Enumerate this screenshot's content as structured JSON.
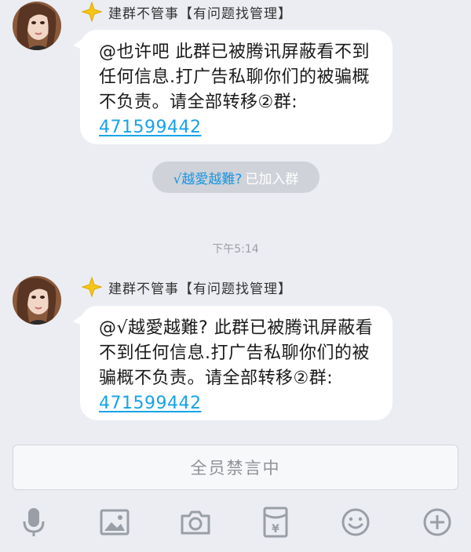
{
  "messages": [
    {
      "sender": "建群不管事【有问题找管理】",
      "text": "@也许吧 此群已被腾讯屏蔽看不到任何信息.打广告私聊你们的被骗概不负责。请全部转移②群:",
      "qq": "471599442"
    },
    {
      "sender": "建群不管事【有问题找管理】",
      "text": "@√越愛越難? 此群已被腾讯屏蔽看不到任何信息.打广告私聊你们的被骗概不负责。请全部转移②群:",
      "qq": "471599442"
    }
  ],
  "system_notice": {
    "user": "√越愛越難?",
    "action": "已加入群"
  },
  "timestamp": "下午5:14",
  "input": {
    "mute_text": "全员禁言中"
  },
  "toolbar": {
    "icons": [
      "microphone-icon",
      "image-icon",
      "camera-icon",
      "red-envelope-icon",
      "emoji-icon",
      "plus-icon"
    ]
  },
  "colors": {
    "background": "#ebedf2",
    "bubble": "#ffffff",
    "link": "#17a2e8",
    "system_pill": "#cfd2d9",
    "icon": "#9a9ea6"
  }
}
